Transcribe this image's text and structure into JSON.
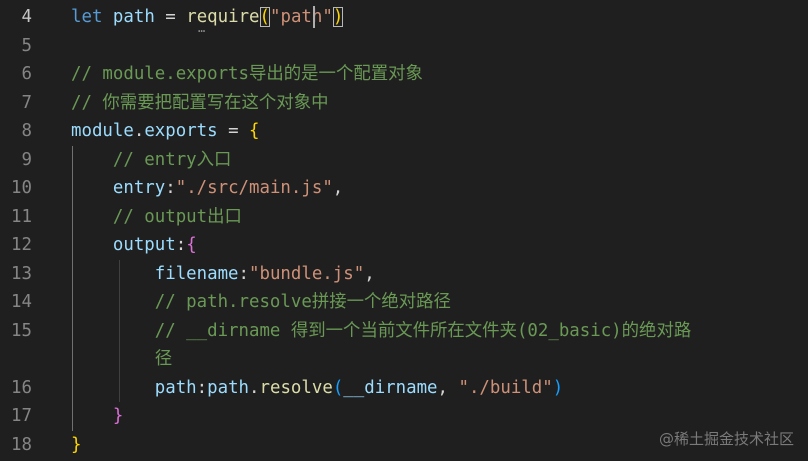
{
  "editor": {
    "lines": [
      {
        "num": "4",
        "tokens": [
          {
            "t": "let",
            "c": "kw"
          },
          {
            "t": " ",
            "c": "pun"
          },
          {
            "t": "path",
            "c": "var"
          },
          {
            "t": " = ",
            "c": "pun"
          },
          {
            "t": "require",
            "c": "fn"
          },
          {
            "t": "(",
            "c": "br1"
          },
          {
            "t": "\"path\"",
            "c": "str"
          },
          {
            "t": ")",
            "c": "br1"
          }
        ]
      },
      {
        "num": "5",
        "tokens": []
      },
      {
        "num": "6",
        "tokens": [
          {
            "t": "// module.exports导出的是一个配置对象",
            "c": "cm"
          }
        ]
      },
      {
        "num": "7",
        "tokens": [
          {
            "t": "// 你需要把配置写在这个对象中",
            "c": "cm"
          }
        ]
      },
      {
        "num": "8",
        "tokens": [
          {
            "t": "module",
            "c": "var"
          },
          {
            "t": ".",
            "c": "pun"
          },
          {
            "t": "exports",
            "c": "var"
          },
          {
            "t": " = ",
            "c": "pun"
          },
          {
            "t": "{",
            "c": "br1"
          }
        ]
      },
      {
        "num": "9",
        "tokens": [
          {
            "t": "    ",
            "c": "pun"
          },
          {
            "t": "// entry入口",
            "c": "cm"
          }
        ]
      },
      {
        "num": "10",
        "tokens": [
          {
            "t": "    ",
            "c": "pun"
          },
          {
            "t": "entry",
            "c": "var"
          },
          {
            "t": ":",
            "c": "pun"
          },
          {
            "t": "\"./src/main.js\"",
            "c": "str"
          },
          {
            "t": ",",
            "c": "pun"
          }
        ]
      },
      {
        "num": "11",
        "tokens": [
          {
            "t": "    ",
            "c": "pun"
          },
          {
            "t": "// output出口",
            "c": "cm"
          }
        ]
      },
      {
        "num": "12",
        "tokens": [
          {
            "t": "    ",
            "c": "pun"
          },
          {
            "t": "output",
            "c": "var"
          },
          {
            "t": ":",
            "c": "pun"
          },
          {
            "t": "{",
            "c": "br2"
          }
        ]
      },
      {
        "num": "13",
        "tokens": [
          {
            "t": "        ",
            "c": "pun"
          },
          {
            "t": "filename",
            "c": "var"
          },
          {
            "t": ":",
            "c": "pun"
          },
          {
            "t": "\"bundle.js\"",
            "c": "str"
          },
          {
            "t": ",",
            "c": "pun"
          }
        ]
      },
      {
        "num": "14",
        "tokens": [
          {
            "t": "        ",
            "c": "pun"
          },
          {
            "t": "// path.resolve拼接一个绝对路径",
            "c": "cm"
          }
        ]
      },
      {
        "num": "15",
        "tokens": [
          {
            "t": "        ",
            "c": "pun"
          },
          {
            "t": "// __dirname 得到一个当前文件所在文件夹(02_basic)的绝对路",
            "c": "cm"
          }
        ]
      },
      {
        "num": "",
        "tokens": [
          {
            "t": "        ",
            "c": "pun"
          },
          {
            "t": "径",
            "c": "cm"
          }
        ]
      },
      {
        "num": "16",
        "tokens": [
          {
            "t": "        ",
            "c": "pun"
          },
          {
            "t": "path",
            "c": "var"
          },
          {
            "t": ":",
            "c": "pun"
          },
          {
            "t": "path",
            "c": "var"
          },
          {
            "t": ".",
            "c": "pun"
          },
          {
            "t": "resolve",
            "c": "fn"
          },
          {
            "t": "(",
            "c": "br3"
          },
          {
            "t": "__dirname",
            "c": "var"
          },
          {
            "t": ", ",
            "c": "pun"
          },
          {
            "t": "\"./build\"",
            "c": "str"
          },
          {
            "t": ")",
            "c": "br3"
          }
        ]
      },
      {
        "num": "17",
        "tokens": [
          {
            "t": "    ",
            "c": "pun"
          },
          {
            "t": "}",
            "c": "br2"
          }
        ]
      },
      {
        "num": "18",
        "tokens": [
          {
            "t": "}",
            "c": "br1"
          }
        ]
      }
    ],
    "active_line": "4",
    "colors": {
      "background": "#1f1f1f",
      "keyword": "#569cd6",
      "variable": "#9cdcfe",
      "function": "#dcdcaa",
      "string": "#ce9178",
      "comment": "#6a9955"
    }
  },
  "watermark": {
    "text": "@稀土掘金技术社区"
  }
}
